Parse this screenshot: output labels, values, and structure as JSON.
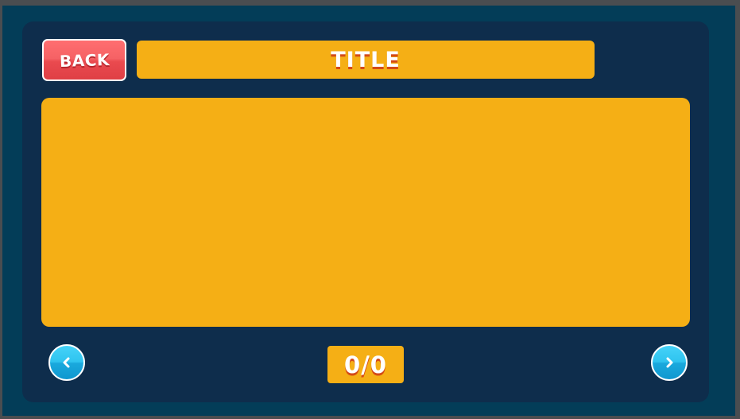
{
  "header": {
    "back_label": "BACK",
    "title": "TITLE"
  },
  "pager": {
    "counter": "0/0",
    "prev_icon": "chevron-left-icon",
    "next_icon": "chevron-right-icon"
  },
  "colors": {
    "background": "#033d58",
    "panel": "#0e2d4c",
    "accent_yellow": "#f5af15",
    "back_button_red": "#ea4a4f",
    "nav_button_blue": "#2fc4ef",
    "text_shadow_orange": "#d44a16"
  }
}
